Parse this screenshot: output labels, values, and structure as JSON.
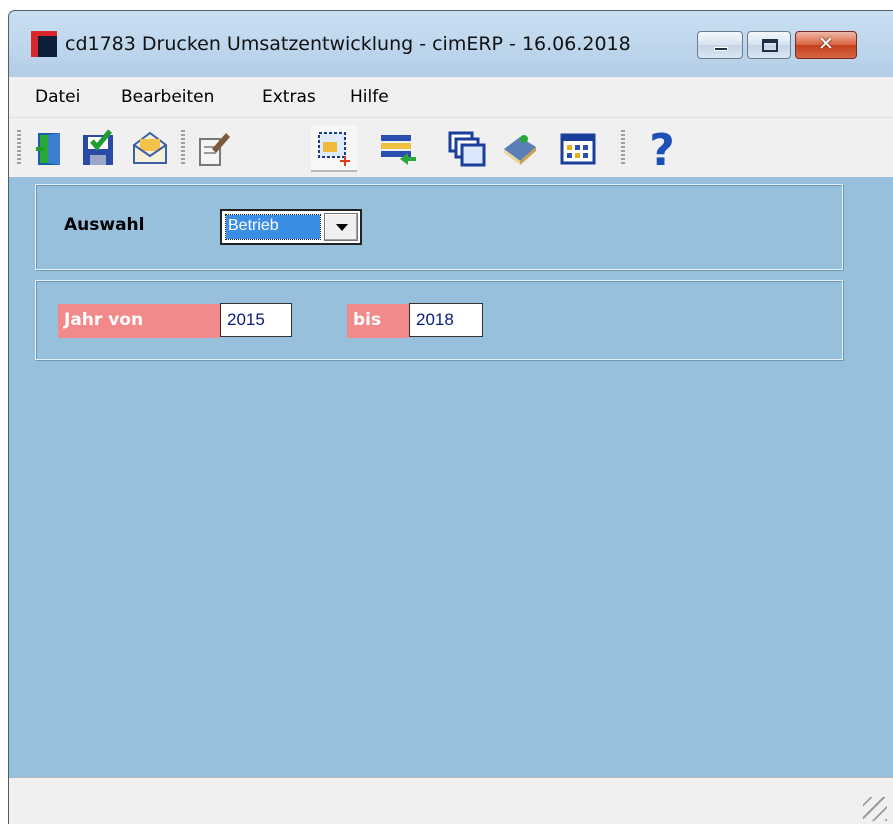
{
  "window": {
    "title": "cd1783 Drucken Umsatzentwicklung - cimERP - 16.06.2018"
  },
  "menu": {
    "items": [
      "Datei",
      "Bearbeiten",
      "Extras",
      "Hilfe"
    ]
  },
  "toolbar": {
    "buttons": [
      {
        "icon": "exit-door-icon"
      },
      {
        "icon": "save-icon"
      },
      {
        "icon": "mail-icon"
      },
      {
        "icon": "edit-form-icon"
      },
      {
        "icon": "new-selection-icon",
        "active": true
      },
      {
        "icon": "import-list-icon"
      },
      {
        "icon": "windows-icon"
      },
      {
        "icon": "book-icon"
      },
      {
        "icon": "grid-view-icon"
      },
      {
        "icon": "help-icon"
      }
    ]
  },
  "form": {
    "auswahl_label": "Auswahl",
    "auswahl_value": "Betrieb",
    "jahr_von_label": "Jahr von",
    "jahr_von_value": "2015",
    "bis_label": "bis",
    "bis_value": "2018"
  },
  "colors": {
    "client_bg": "#97c0dc",
    "label_red": "#f2898b",
    "selection_blue": "#3a8ee6"
  }
}
